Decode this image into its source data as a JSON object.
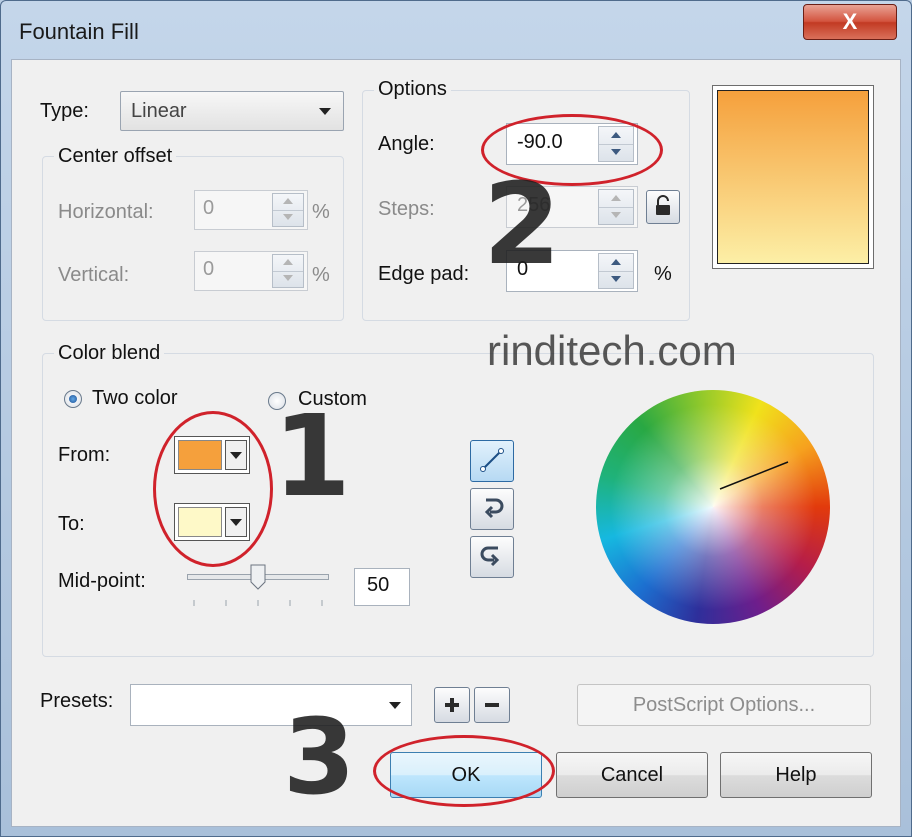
{
  "window": {
    "title": "Fountain Fill",
    "close_glyph": "X"
  },
  "type_row": {
    "label": "Type:",
    "value": "Linear"
  },
  "center_offset": {
    "title": "Center offset",
    "horizontal_label": "Horizontal:",
    "horizontal_value": "0",
    "vertical_label": "Vertical:",
    "vertical_value": "0",
    "unit": "%"
  },
  "options": {
    "title": "Options",
    "angle_label": "Angle:",
    "angle_value": "-90.0",
    "steps_label": "Steps:",
    "steps_value": "256",
    "edge_pad_label": "Edge pad:",
    "edge_pad_value": "0",
    "edge_pad_unit": "%"
  },
  "color_blend": {
    "title": "Color blend",
    "two_color_label": "Two color",
    "custom_label": "Custom",
    "selected": "two_color",
    "from_label": "From:",
    "to_label": "To:",
    "from_color": "#f5a03c",
    "to_color": "#fef9c8",
    "midpoint_label": "Mid-point:",
    "midpoint_value": "50"
  },
  "preview": {
    "start_color": "#f5a03c",
    "end_color": "#fcefa6"
  },
  "presets": {
    "label": "Presets:",
    "value": ""
  },
  "buttons": {
    "postscript": "PostScript Options...",
    "ok": "OK",
    "cancel": "Cancel",
    "help": "Help"
  },
  "annotations": {
    "num1": "1",
    "num2": "2",
    "num3": "3",
    "watermark": "rinditech.com"
  }
}
